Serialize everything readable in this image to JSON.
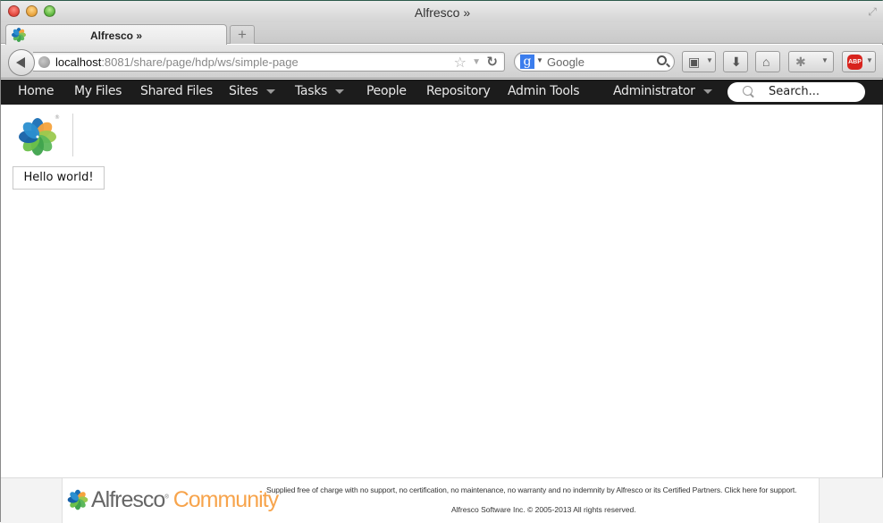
{
  "window": {
    "title": "Alfresco »"
  },
  "tabs": [
    {
      "title": "Alfresco »",
      "active": true
    }
  ],
  "new_tab_label": "+",
  "navbar": {
    "url_host": "localhost",
    "url_rest": ":8081/share/page/hdp/ws/simple-page",
    "search_engine": "Google",
    "icons": [
      "back-icon",
      "globe-icon",
      "star-icon",
      "dropmarker-icon",
      "reload-icon",
      "google-icon",
      "search-icon",
      "bookmarks-icon",
      "download-icon",
      "home-icon",
      "addon-icon",
      "adblock-icon"
    ],
    "adblock_label": "ABP"
  },
  "app_header": {
    "menu": [
      {
        "label": "Home",
        "dropdown": false
      },
      {
        "label": "My Files",
        "dropdown": false
      },
      {
        "label": "Shared Files",
        "dropdown": false
      },
      {
        "label": "Sites",
        "dropdown": true
      },
      {
        "label": "Tasks",
        "dropdown": true
      },
      {
        "label": "People",
        "dropdown": false
      },
      {
        "label": "Repository",
        "dropdown": false
      },
      {
        "label": "Admin Tools",
        "dropdown": false
      }
    ],
    "user_menu": {
      "label": "Administrator",
      "dropdown": true
    },
    "search_placeholder": "Search..."
  },
  "content": {
    "hello_button_label": "Hello world!"
  },
  "footer": {
    "brand_name": "Alfresco",
    "brand_reg": "®",
    "brand_edition": "Community",
    "notice": "Supplied free of charge with no support, no certification, no maintenance, no warranty and no indemnity by Alfresco or its Certified Partners. Click here for support.",
    "copyright": "Alfresco Software Inc. © 2005-2013 All rights reserved."
  },
  "colors": {
    "header_bg": "#1c1c1c",
    "community_orange": "#f7a44c",
    "logo_blue": "#1a6fb5",
    "logo_green": "#5cb85c",
    "logo_orange": "#f6a33d"
  }
}
